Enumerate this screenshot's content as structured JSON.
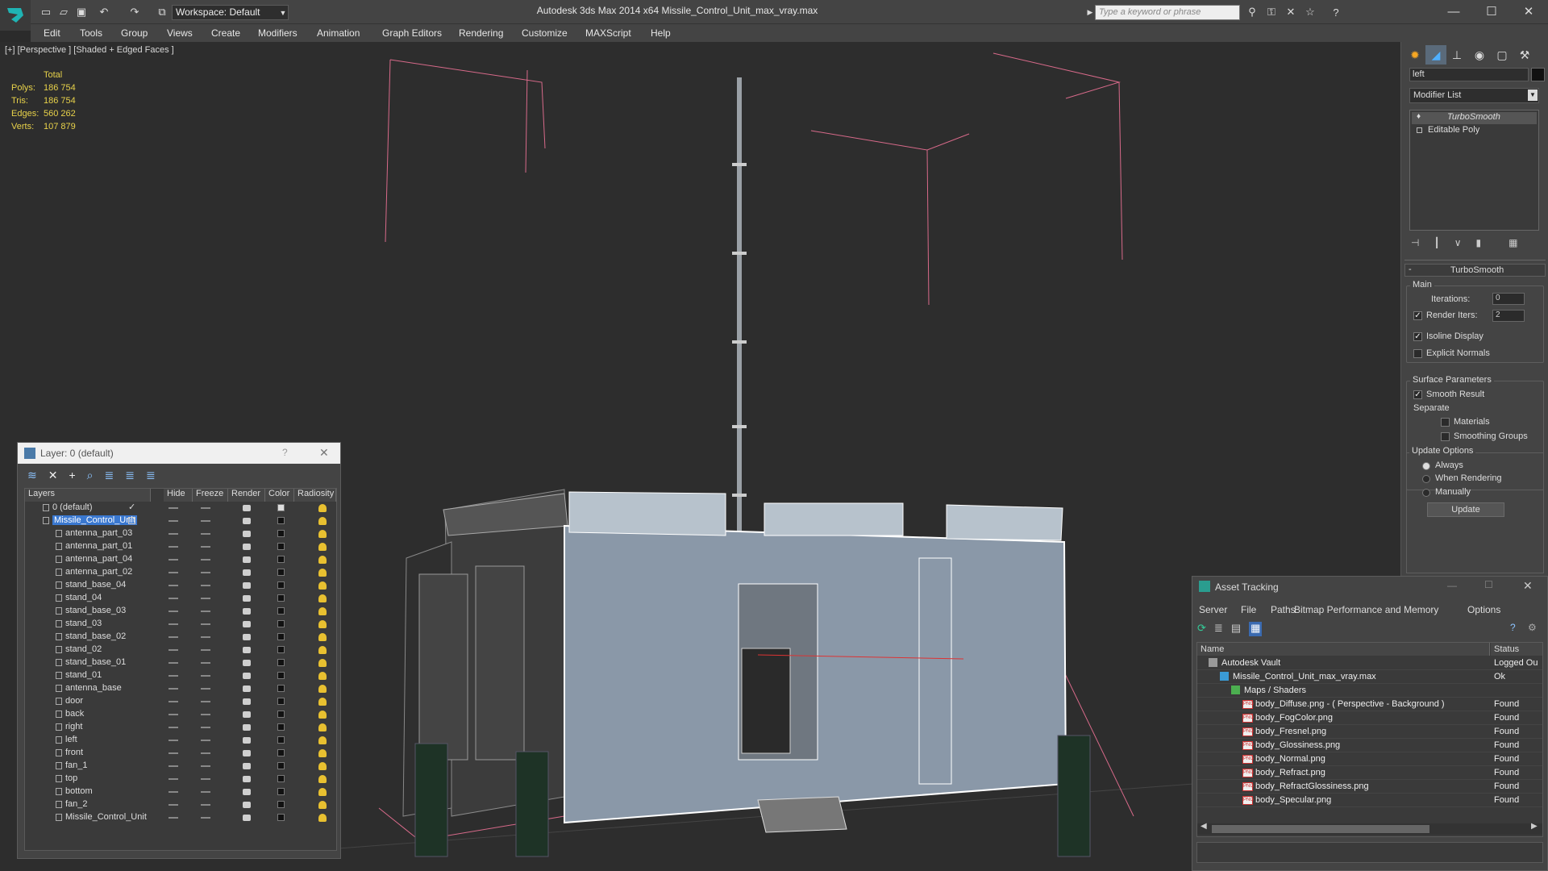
{
  "titlebar": {
    "workspace": "Workspace: Default",
    "title": "Autodesk 3ds Max  2014 x64        Missile_Control_Unit_max_vray.max",
    "search_placeholder": "Type a keyword or phrase"
  },
  "menu": [
    "Edit",
    "Tools",
    "Group",
    "Views",
    "Create",
    "Modifiers",
    "Animation",
    "Graph Editors",
    "Rendering",
    "Customize",
    "MAXScript",
    "Help"
  ],
  "viewport": {
    "label": "[+] [Perspective ] [Shaded + Edged Faces ]",
    "stats": {
      "header": "Total",
      "rows": [
        {
          "k": "Polys:",
          "v": "186 754"
        },
        {
          "k": "Tris:",
          "v": "186 754"
        },
        {
          "k": "Edges:",
          "v": "560 262"
        },
        {
          "k": "Verts:",
          "v": "107 879"
        }
      ]
    }
  },
  "command_panel": {
    "object_name": "left",
    "modifier_list": "Modifier List",
    "stack": [
      "TurboSmooth",
      "Editable Poly"
    ],
    "turbosmooth": {
      "title": "TurboSmooth",
      "main": "Main",
      "iterations_label": "Iterations:",
      "iterations": "0",
      "render_iters_label": "Render Iters:",
      "render_iters": "2",
      "isoline": "Isoline Display",
      "explicit_normals": "Explicit Normals",
      "surface_params": "Surface Parameters",
      "smooth_result": "Smooth Result",
      "separate": "Separate",
      "materials": "Materials",
      "smoothing_groups": "Smoothing Groups",
      "update_options": "Update Options",
      "always": "Always",
      "when_rendering": "When Rendering",
      "manually": "Manually",
      "update": "Update"
    }
  },
  "layer_manager": {
    "title": "Layer: 0 (default)",
    "help": "?",
    "columns": [
      "Layers",
      "Hide",
      "Freeze",
      "Render",
      "Color",
      "Radiosity"
    ],
    "layers": [
      "0 (default)",
      "Missile_Control_Unit"
    ],
    "objects": [
      "antenna_part_03",
      "antenna_part_01",
      "antenna_part_04",
      "antenna_part_02",
      "stand_base_04",
      "stand_04",
      "stand_base_03",
      "stand_03",
      "stand_base_02",
      "stand_02",
      "stand_base_01",
      "stand_01",
      "antenna_base",
      "door",
      "back",
      "right",
      "left",
      "front",
      "fan_1",
      "top",
      "bottom",
      "fan_2",
      "Missile_Control_Unit"
    ]
  },
  "asset_tracking": {
    "title": "Asset Tracking",
    "menu": [
      "Server",
      "File",
      "Paths",
      "Bitmap Performance and Memory",
      "Options"
    ],
    "columns": [
      "Name",
      "Status"
    ],
    "rows": [
      {
        "name": "Autodesk Vault",
        "status": "Logged Ou"
      },
      {
        "name": "Missile_Control_Unit_max_vray.max",
        "status": "Ok"
      },
      {
        "name": "Maps / Shaders",
        "status": ""
      },
      {
        "name": "body_Diffuse.png -  ( Perspective - Background )",
        "status": "Found"
      },
      {
        "name": "body_FogColor.png",
        "status": "Found"
      },
      {
        "name": "body_Fresnel.png",
        "status": "Found"
      },
      {
        "name": "body_Glossiness.png",
        "status": "Found"
      },
      {
        "name": "body_Normal.png",
        "status": "Found"
      },
      {
        "name": "body_Refract.png",
        "status": "Found"
      },
      {
        "name": "body_RefractGlossiness.png",
        "status": "Found"
      },
      {
        "name": "body_Specular.png",
        "status": "Found"
      }
    ]
  }
}
